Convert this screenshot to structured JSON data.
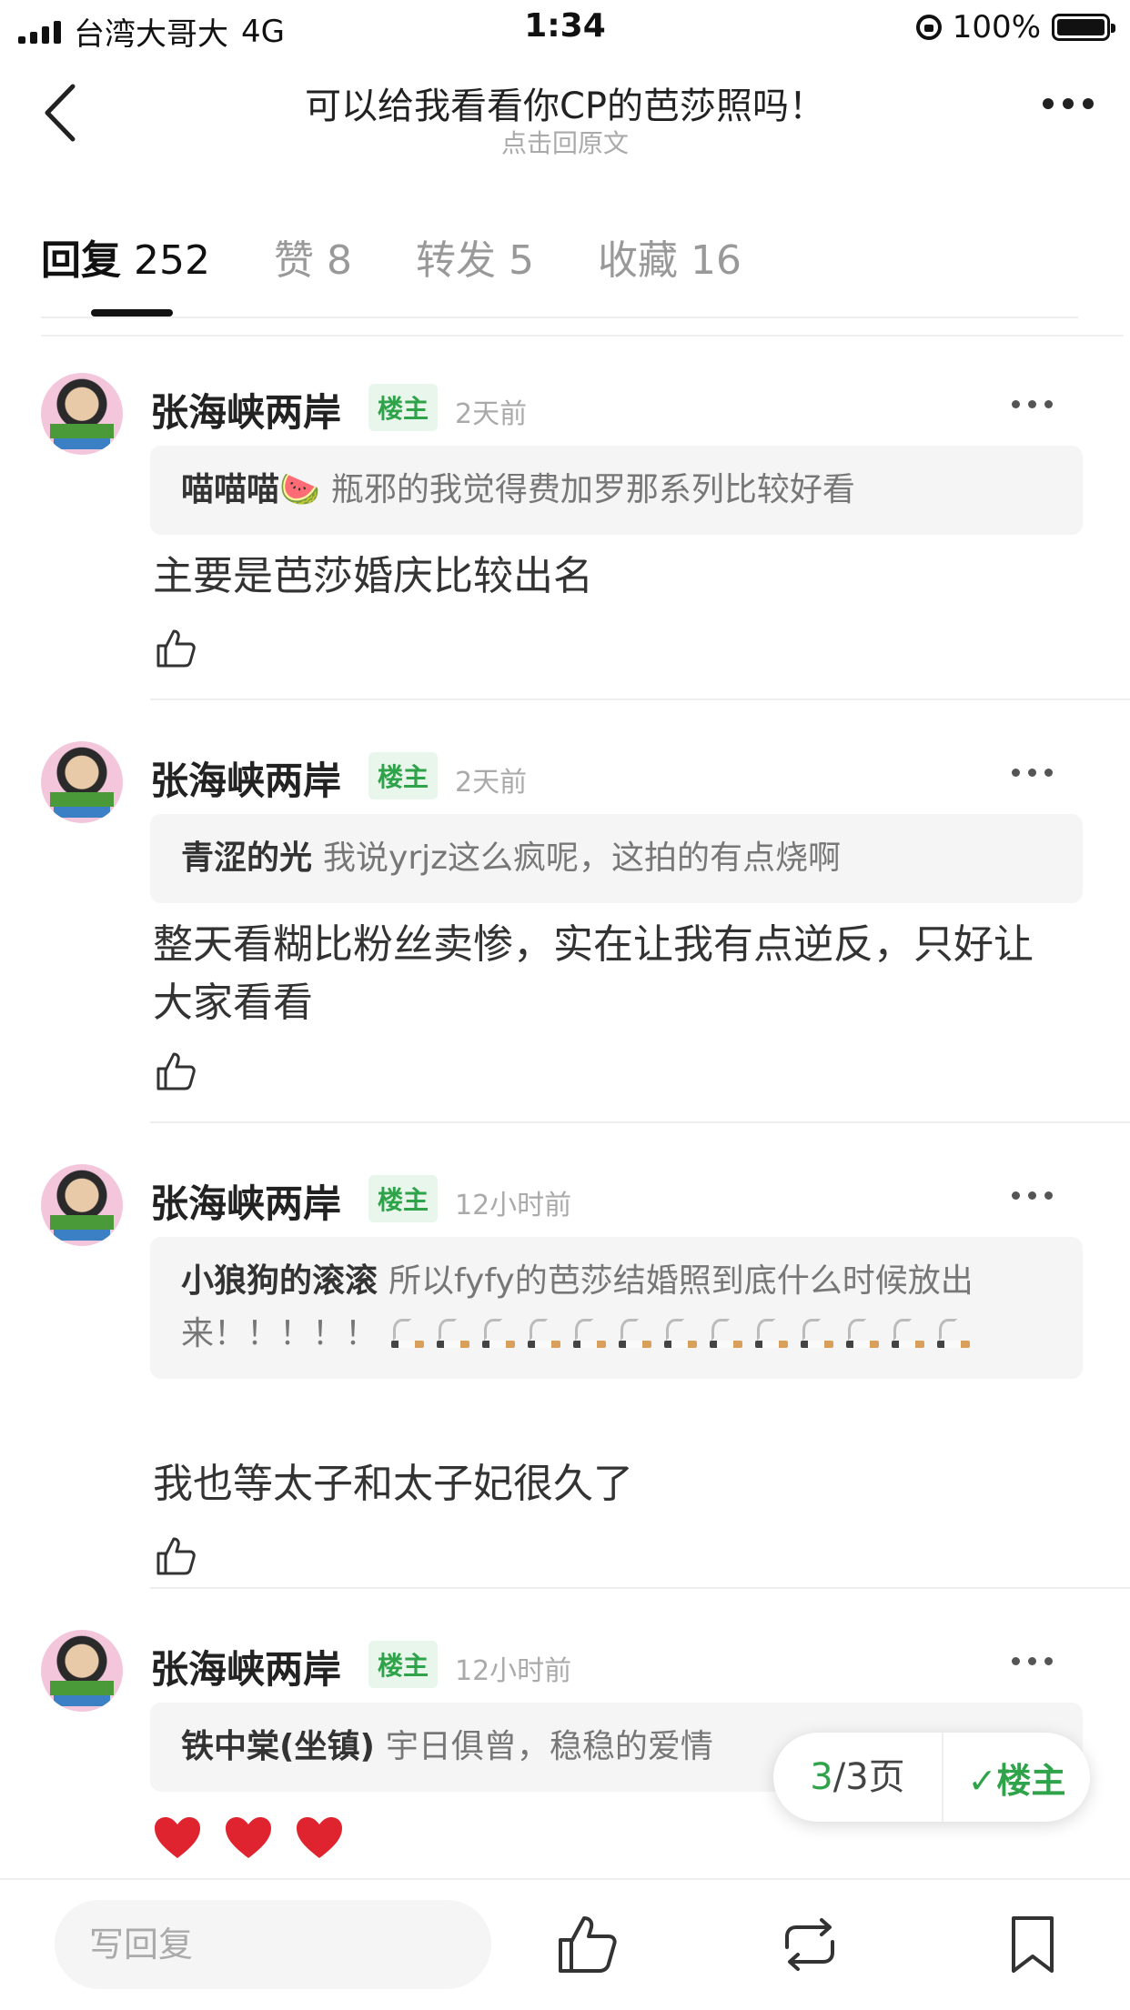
{
  "status_bar": {
    "carrier": "台湾大哥大",
    "network": "4G",
    "time": "1:34",
    "battery": "100%"
  },
  "nav": {
    "title": "可以给我看看你CP的芭莎照吗！",
    "subtitle": "点击回原文"
  },
  "tabs": [
    {
      "label": "回复",
      "count": "252"
    },
    {
      "label": "赞",
      "count": "8"
    },
    {
      "label": "转发",
      "count": "5"
    },
    {
      "label": "收藏",
      "count": "16"
    }
  ],
  "replies": [
    {
      "username": "张海峡两岸",
      "badge": "楼主",
      "time": "2天前",
      "quote_name": "喵喵喵🍉",
      "quote_text": "瓶邪的我觉得费加罗那系列比较好看",
      "content": "主要是芭莎婚庆比较出名"
    },
    {
      "username": "张海峡两岸",
      "badge": "楼主",
      "time": "2天前",
      "quote_name": "青涩的光",
      "quote_text": "我说yrjz这么疯呢，这拍的有点烧啊",
      "content": "整天看糊比粉丝卖惨，实在让我有点逆反，只好让大家看看"
    },
    {
      "username": "张海峡两岸",
      "badge": "楼主",
      "time": "12小时前",
      "quote_name": "小狼狗的滚滚",
      "quote_text": "所以fyfy的芭莎结婚照到底什么时候放出来！！！！！",
      "content": "我也等太子和太子妃很久了"
    },
    {
      "username": "张海峡两岸",
      "badge": "楼主",
      "time": "12小时前",
      "quote_name": "铁中棠(坐镇)",
      "quote_text": "宇日俱曾，稳稳的爱情",
      "content": ""
    }
  ],
  "pager": {
    "current": "3",
    "total_text": "/3页",
    "owner_label": "楼主"
  },
  "bottom_bar": {
    "reply_placeholder": "写回复"
  },
  "colors": {
    "accent_green": "#2fa34a",
    "heart_red": "#e0242f"
  }
}
